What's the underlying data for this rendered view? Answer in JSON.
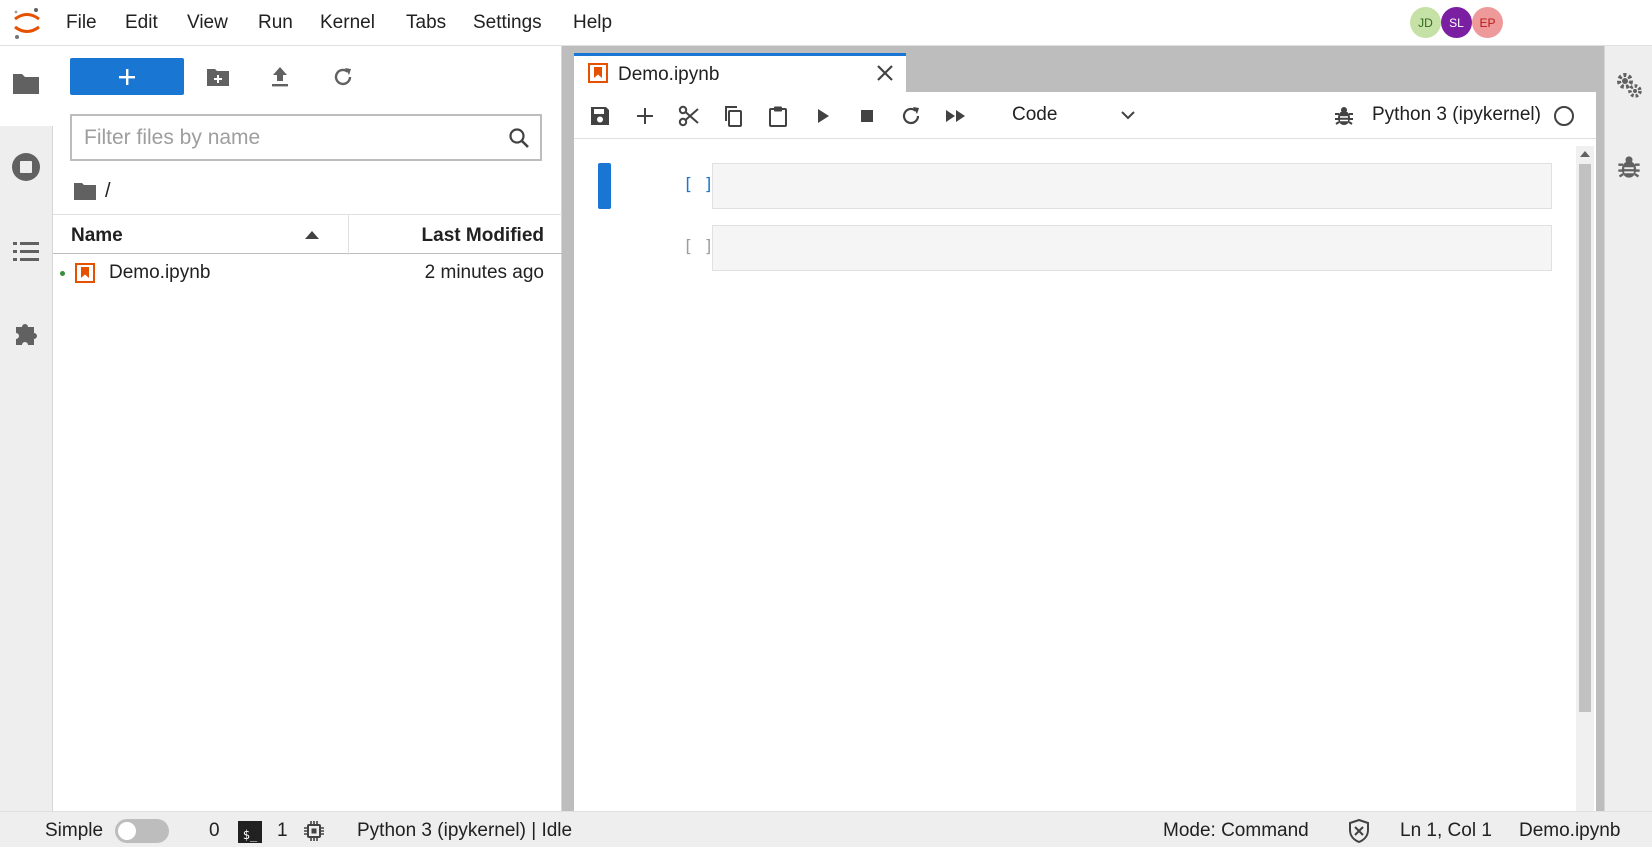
{
  "menubar": {
    "items": [
      "File",
      "Edit",
      "View",
      "Run",
      "Kernel",
      "Tabs",
      "Settings",
      "Help"
    ],
    "users": [
      {
        "initials": "JD",
        "color": "#c5e1a5",
        "text_color": "#33691e"
      },
      {
        "initials": "SL",
        "color": "#7b1fa2",
        "text_color": "#ffffff"
      },
      {
        "initials": "EP",
        "color": "#ef9a9a",
        "text_color": "#b71c1c"
      }
    ]
  },
  "left_sidebar": {
    "icons": [
      "folder-icon",
      "running-icon",
      "toc-icon",
      "extension-icon"
    ],
    "active": "folder-icon"
  },
  "file_browser": {
    "new_button_icon": "plus-icon",
    "toolbar_icons": [
      "new-folder-icon",
      "upload-icon",
      "refresh-icon"
    ],
    "filter_placeholder": "Filter files by name",
    "breadcrumb": "/",
    "columns": {
      "name": "Name",
      "last_modified": "Last Modified"
    },
    "files": [
      {
        "name": "Demo.ipynb",
        "modified": "2 minutes ago",
        "running": true
      }
    ]
  },
  "notebook": {
    "tab_label": "Demo.ipynb",
    "toolbar_icons": [
      "save-icon",
      "add-cell-icon",
      "cut-icon",
      "copy-icon",
      "paste-icon",
      "run-icon",
      "stop-icon",
      "restart-icon",
      "run-all-icon"
    ],
    "cell_type": "Code",
    "kernel_name": "Python 3 (ipykernel)",
    "kernel_idle": true,
    "cells": [
      {
        "prompt": "[ ]:",
        "active": true,
        "content": ""
      },
      {
        "prompt": "[ ]:",
        "active": false,
        "content": ""
      }
    ]
  },
  "right_sidebar": {
    "icons": [
      "property-inspector-icon",
      "debugger-icon"
    ]
  },
  "statusbar": {
    "simple_label": "Simple",
    "simple_enabled": false,
    "terminals_count": "0",
    "terminal_glyph": "$_",
    "kernels_count": "1",
    "kernel_status": "Python 3 (ipykernel) | Idle",
    "mode": "Mode: Command",
    "cursor": "Ln 1, Col 1",
    "filename": "Demo.ipynb"
  },
  "colors": {
    "accent": "#1976d2",
    "notebook_orange": "#e65100",
    "running_green": "#388e3c"
  }
}
